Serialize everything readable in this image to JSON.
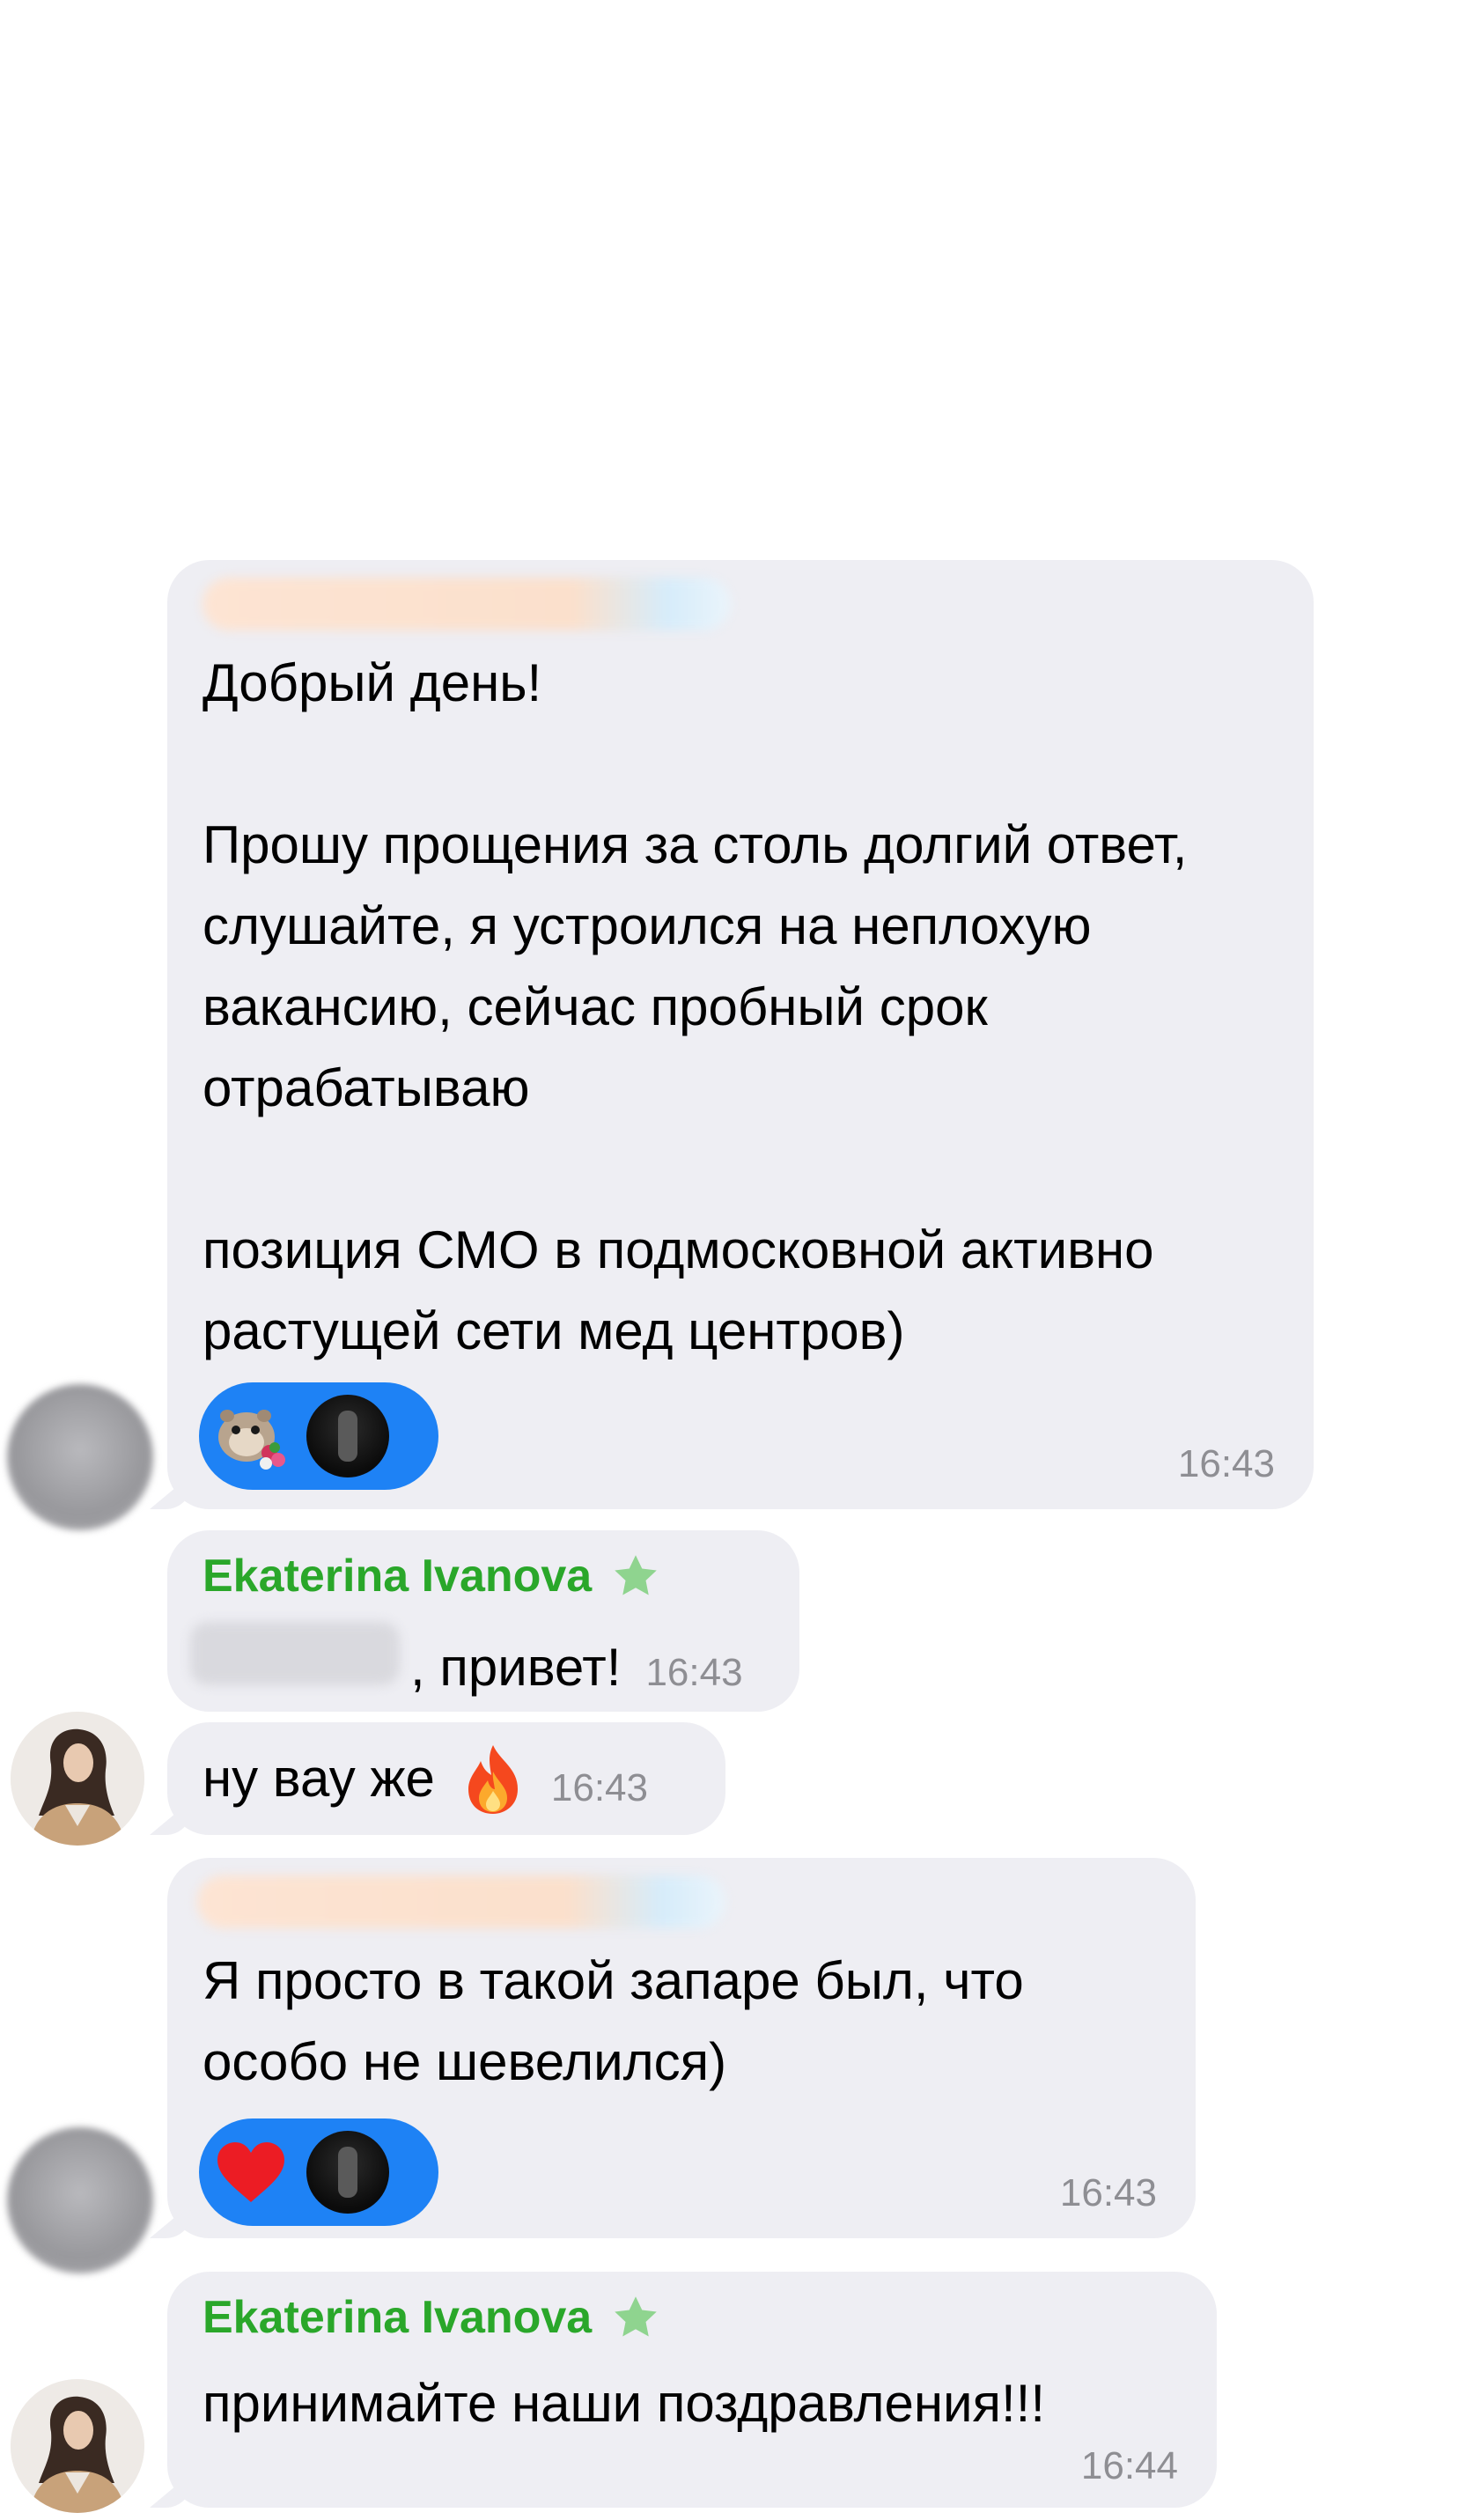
{
  "messages": [
    {
      "id": 1,
      "text": "Добрый день!\n\nПрошу прощения за столь долгий ответ, слушайте, я устроился на неплохую вакансию, сейчас пробный срок отрабатываю\n\nпозиция СМО в подмосковной активно растущей сети мед центров)",
      "time": "16:43",
      "reactions": [
        "hamster-flowers-emoji",
        "user-avatar"
      ]
    },
    {
      "id": 2,
      "sender": "Ekaterina Ivanova",
      "text": ", привет!",
      "time": "16:43"
    },
    {
      "id": 3,
      "text": "ну вау же",
      "emoji": "🔥",
      "time": "16:43"
    },
    {
      "id": 4,
      "text": "Я просто в такой запаре был, что особо не шевелился)",
      "time": "16:43",
      "reactions": [
        "heart-emoji",
        "user-avatar"
      ]
    },
    {
      "id": 5,
      "sender": "Ekaterina Ivanova",
      "text": "принимайте наши поздравления!!!",
      "time": "16:44"
    }
  ],
  "colors": {
    "bubble": "#eeeef3",
    "sender_name": "#2aa72a",
    "reaction_pill": "#1e82f5",
    "timestamp": "#8e8e93"
  }
}
